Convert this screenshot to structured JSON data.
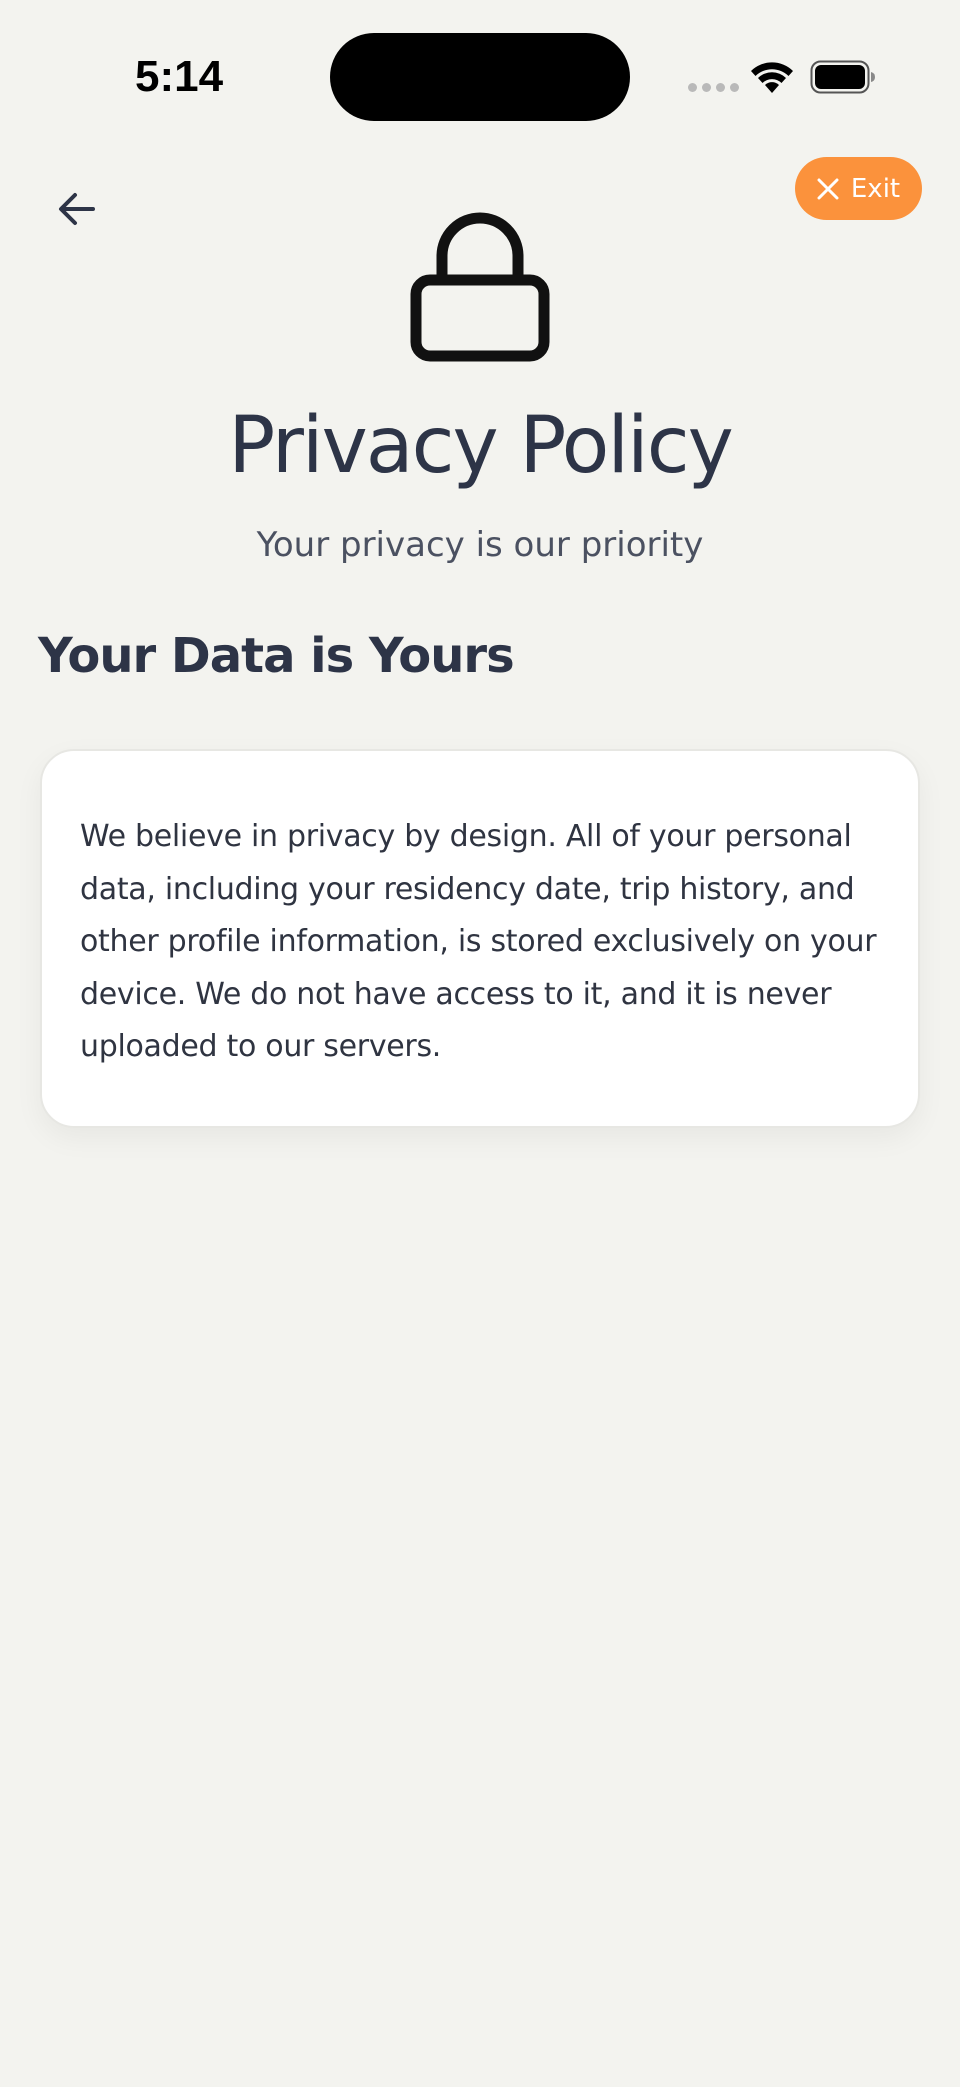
{
  "status_bar": {
    "time": "5:14"
  },
  "header": {
    "back_icon": "arrow-left-icon",
    "exit_label": "Exit",
    "exit_icon": "close-icon"
  },
  "hero": {
    "icon": "lock-icon",
    "title": "Privacy Policy",
    "subtitle": "Your privacy is our priority"
  },
  "section": {
    "heading": "Your Data is Yours",
    "body": "We believe in privacy by design. All of your personal data, including your residency date, trip history, and other profile information, is stored exclusively on your device. We do not have access to it, and it is never uploaded to our servers."
  },
  "colors": {
    "background": "#f3f3ef",
    "accent": "#fb923c",
    "text": "#2d3447",
    "card": "#ffffff"
  }
}
